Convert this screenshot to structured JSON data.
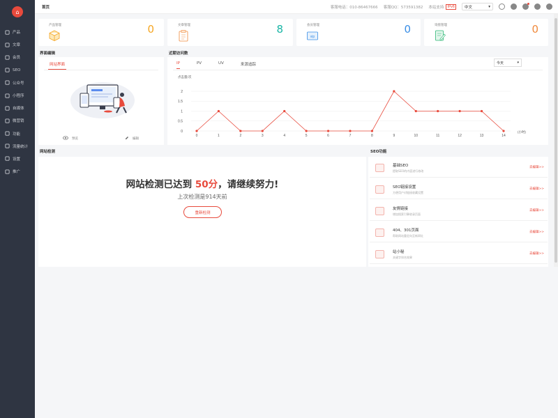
{
  "sidebar": {
    "items": [
      {
        "label": "产品",
        "icon": "grid-icon"
      },
      {
        "label": "文章",
        "icon": "document-icon"
      },
      {
        "label": "会员",
        "icon": "users-icon"
      },
      {
        "label": "SEO",
        "icon": "seo-icon"
      },
      {
        "label": "公众号",
        "icon": "wechat-icon"
      },
      {
        "label": "小程序",
        "icon": "miniprogram-icon"
      },
      {
        "label": "自媒体",
        "icon": "media-icon"
      },
      {
        "label": "微营销",
        "icon": "marketing-icon"
      },
      {
        "label": "功能",
        "icon": "puzzle-icon"
      },
      {
        "label": "流量统计",
        "icon": "chart-icon"
      },
      {
        "label": "设置",
        "icon": "settings-icon"
      },
      {
        "label": "推广",
        "icon": "promote-icon"
      }
    ]
  },
  "topbar": {
    "home": "首页",
    "phone": "客服电话：010-86467666",
    "qq": "客服QQ：573591382",
    "ipv6_label": "本站支持",
    "ipv6_badge": "IPv6",
    "language": "中文"
  },
  "stats": [
    {
      "label": "产品管理",
      "value": "0",
      "color": "#f5a623"
    },
    {
      "label": "文章管理",
      "value": "8",
      "color": "#19b5a5"
    },
    {
      "label": "会员管理",
      "value": "0",
      "color": "#3a8ee6"
    },
    {
      "label": "询盘管理",
      "value": "0",
      "color": "#f08a3c"
    }
  ],
  "ui_edit": {
    "title": "界面编辑",
    "tab": "网站界面",
    "preview": "预览",
    "edit": "编辑"
  },
  "visits": {
    "title": "近期访问数",
    "tabs": [
      "IP",
      "PV",
      "UV",
      "来源追踪"
    ],
    "range": "今天",
    "ylabel": "点击量/次",
    "xunit": "(小时)"
  },
  "chart_data": {
    "type": "line",
    "x": [
      0,
      1,
      2,
      3,
      4,
      5,
      6,
      7,
      8,
      9,
      10,
      11,
      12,
      13,
      14
    ],
    "values": [
      0,
      1,
      0,
      0,
      1,
      0,
      0,
      0,
      0,
      2,
      1,
      1,
      1,
      1,
      0
    ],
    "ylim": [
      0,
      2
    ],
    "yticks": [
      0,
      0.5,
      1,
      1.5,
      2
    ],
    "ytick_labels": [
      "0",
      "0.5",
      "1",
      "1.5",
      "2"
    ],
    "ylabel": "点击量/次",
    "xlabel": "(小时)",
    "color": "#e84a3c"
  },
  "site_check": {
    "title": "网站检测",
    "headline_pre": "网站检测已达到 ",
    "score": "50分",
    "headline_post": "，请继续努力!",
    "last": "上次检测是914天前",
    "button": "重新检测"
  },
  "seo": {
    "title": "SEO功能",
    "go": "去编辑>>",
    "items": [
      {
        "title": "基础SEO",
        "desc": "提取SEO的内容进行修改"
      },
      {
        "title": "SEO链接设置",
        "desc": "方便用户对链接收藏设置"
      },
      {
        "title": "友情链接",
        "desc": "增加搜索引擎收录页面"
      },
      {
        "title": "404、301页面",
        "desc": "帮助网站重定向至新网址"
      },
      {
        "title": "站小秘",
        "desc": "关键字排名效果"
      }
    ]
  }
}
